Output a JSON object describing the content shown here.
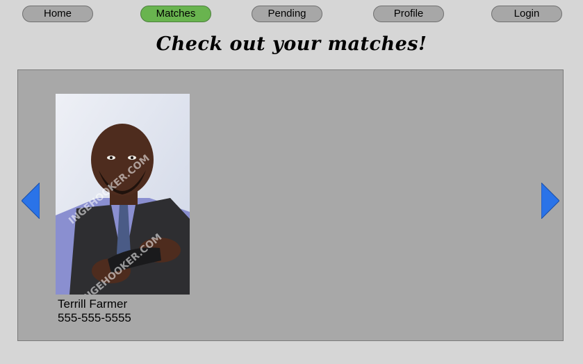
{
  "nav": {
    "home": "Home",
    "matches": "Matches",
    "pending": "Pending",
    "profile": "Profile",
    "login": "Login",
    "active": "matches",
    "active_color": "#69b44f"
  },
  "heading": "Check out your matches!",
  "arrows": {
    "left_icon": "arrow-left-icon",
    "right_icon": "arrow-right-icon",
    "color": "#2a73e8"
  },
  "matches": [
    {
      "name": "Terrill Farmer",
      "phone": "555-555-5555",
      "photo_watermark": "INGEHOOKER.COM"
    }
  ]
}
